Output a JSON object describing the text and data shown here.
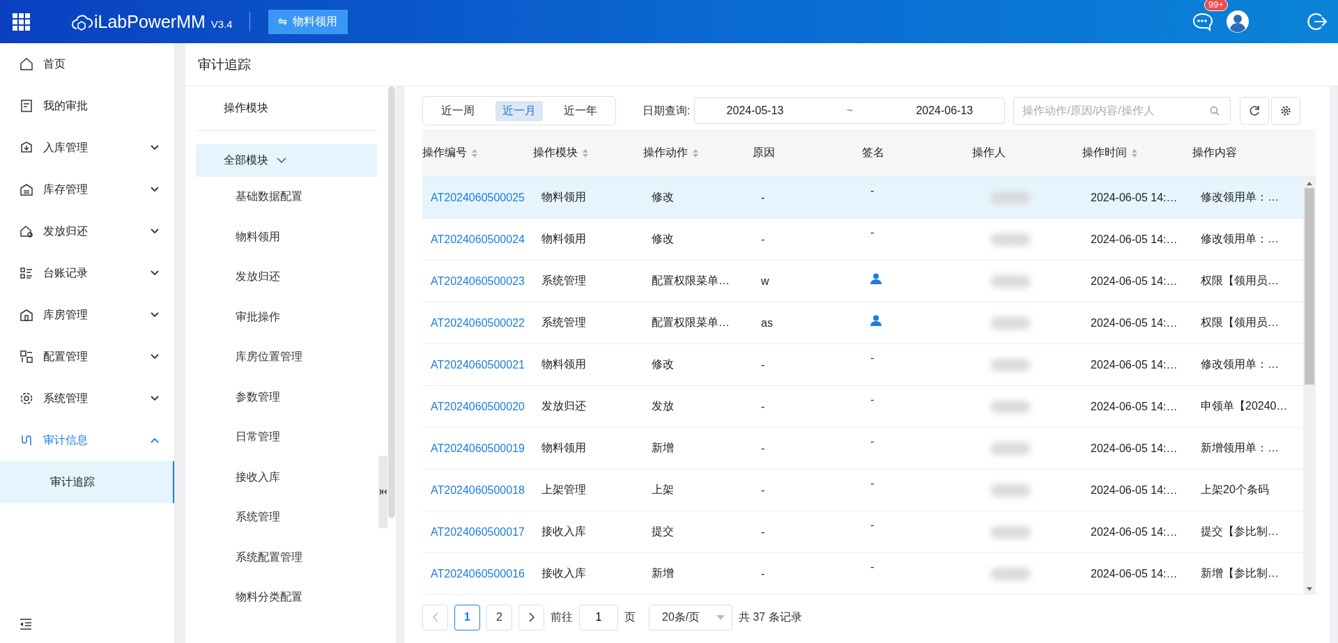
{
  "header": {
    "app_name": "iLabPowerMM",
    "version": "V3.4",
    "switch_button": {
      "icon": "⇋",
      "label": "物料领用"
    },
    "badge": "99+"
  },
  "sidebar": {
    "items": [
      {
        "label": "首页",
        "kind": "link",
        "selected": false
      },
      {
        "label": "我的审批",
        "kind": "link",
        "selected": false
      },
      {
        "label": "入库管理",
        "kind": "group",
        "expanded": false,
        "selected": false
      },
      {
        "label": "库存管理",
        "kind": "group",
        "expanded": false,
        "selected": false
      },
      {
        "label": "发放归还",
        "kind": "group",
        "expanded": false,
        "selected": false
      },
      {
        "label": "台账记录",
        "kind": "group",
        "expanded": false,
        "selected": false
      },
      {
        "label": "库房管理",
        "kind": "group",
        "expanded": false,
        "selected": false
      },
      {
        "label": "配置管理",
        "kind": "group",
        "expanded": false,
        "selected": false
      },
      {
        "label": "系统管理",
        "kind": "group",
        "expanded": false,
        "selected": false
      },
      {
        "label": "审计信息",
        "kind": "group",
        "expanded": true,
        "selected": true,
        "children": [
          {
            "label": "审计追踪",
            "selected": true
          }
        ]
      }
    ]
  },
  "page": {
    "title": "审计追踪"
  },
  "modules": {
    "title": "操作模块",
    "root": {
      "label": "全部模块",
      "expanded": true,
      "selected": true,
      "children": [
        {
          "label": "基础数据配置"
        },
        {
          "label": "物料领用"
        },
        {
          "label": "发放归还"
        },
        {
          "label": "审批操作"
        },
        {
          "label": "库房位置管理"
        },
        {
          "label": "参数管理"
        },
        {
          "label": "日常管理"
        },
        {
          "label": "接收入库"
        },
        {
          "label": "系统管理"
        },
        {
          "label": "系统配置管理"
        },
        {
          "label": "物料分类配置"
        }
      ]
    }
  },
  "range_tabs": [
    {
      "label": "近一周",
      "selected": false
    },
    {
      "label": "近一月",
      "selected": true
    },
    {
      "label": "近一年",
      "selected": false
    }
  ],
  "date_query": {
    "label": "日期查询:",
    "start": "2024-05-13",
    "separator": "~",
    "end": "2024-06-13"
  },
  "search": {
    "placeholder": "操作动作/原因/内容/操作人"
  },
  "table": {
    "columns": [
      {
        "label": "操作编号",
        "sortable": true
      },
      {
        "label": "操作模块",
        "sortable": true
      },
      {
        "label": "操作动作",
        "sortable": true
      },
      {
        "label": "原因",
        "sortable": false
      },
      {
        "label": "签名",
        "sortable": false
      },
      {
        "label": "操作人",
        "sortable": false
      },
      {
        "label": "操作时间",
        "sortable": true
      },
      {
        "label": "操作内容",
        "sortable": false
      }
    ],
    "rows": [
      {
        "id": "AT2024060500025",
        "module": "物料领用",
        "action": "修改",
        "reason": "-",
        "signed": false,
        "signature": "-",
        "time": "2024-06-05 14:…",
        "content": "修改领用单：…",
        "selected": true
      },
      {
        "id": "AT2024060500024",
        "module": "物料领用",
        "action": "修改",
        "reason": "-",
        "signed": false,
        "signature": "-",
        "time": "2024-06-05 14:…",
        "content": "修改领用单：…",
        "selected": false
      },
      {
        "id": "AT2024060500023",
        "module": "系统管理",
        "action": "配置权限菜单…",
        "reason": "w",
        "signed": true,
        "time": "2024-06-05 14:…",
        "content": "权限【领用员…",
        "selected": false
      },
      {
        "id": "AT2024060500022",
        "module": "系统管理",
        "action": "配置权限菜单…",
        "reason": "as",
        "signed": true,
        "time": "2024-06-05 14:…",
        "content": "权限【领用员…",
        "selected": false
      },
      {
        "id": "AT2024060500021",
        "module": "物料领用",
        "action": "修改",
        "reason": "-",
        "signed": false,
        "signature": "-",
        "time": "2024-06-05 14:…",
        "content": "修改领用单：…",
        "selected": false
      },
      {
        "id": "AT2024060500020",
        "module": "发放归还",
        "action": "发放",
        "reason": "-",
        "signed": false,
        "signature": "-",
        "time": "2024-06-05 14:…",
        "content": "申领单【20240…",
        "selected": false
      },
      {
        "id": "AT2024060500019",
        "module": "物料领用",
        "action": "新增",
        "reason": "-",
        "signed": false,
        "signature": "-",
        "time": "2024-06-05 14:…",
        "content": "新增领用单：…",
        "selected": false
      },
      {
        "id": "AT2024060500018",
        "module": "上架管理",
        "action": "上架",
        "reason": "-",
        "signed": false,
        "signature": "-",
        "time": "2024-06-05 14:…",
        "content": "上架20个条码",
        "selected": false
      },
      {
        "id": "AT2024060500017",
        "module": "接收入库",
        "action": "提交",
        "reason": "-",
        "signed": false,
        "signature": "-",
        "time": "2024-06-05 14:…",
        "content": "提交【参比制…",
        "selected": false
      },
      {
        "id": "AT2024060500016",
        "module": "接收入库",
        "action": "新增",
        "reason": "-",
        "signed": false,
        "signature": "-",
        "time": "2024-06-05 14:…",
        "content": "新增【参比制…",
        "selected": false
      }
    ]
  },
  "pagination": {
    "pages": [
      {
        "label": "1",
        "selected": true
      },
      {
        "label": "2",
        "selected": false
      }
    ],
    "goto_label": "前往",
    "goto_value": "1",
    "page_unit": "页",
    "page_size": "20条/页",
    "total": "共 37 条记录"
  }
}
